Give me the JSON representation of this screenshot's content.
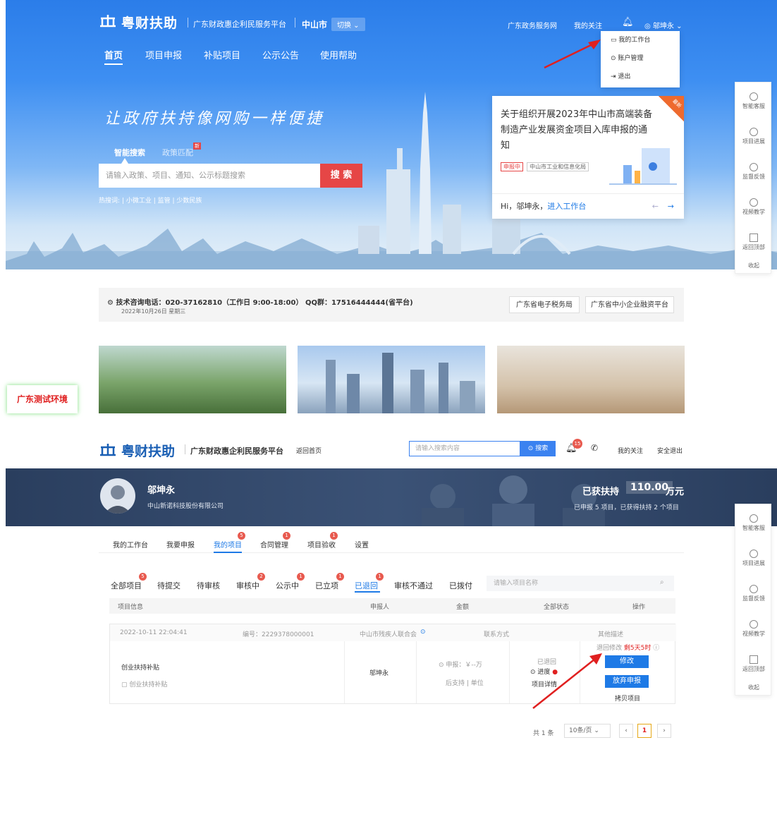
{
  "top": {
    "logo_text": "粤财扶助",
    "platform": "广东财政惠企利民服务平台",
    "city": "中山市",
    "switch_label": "切换",
    "links": [
      "广东政务服务网",
      "我的关注"
    ],
    "user": "邬坤永",
    "nav": [
      "首页",
      "项目申报",
      "补贴项目",
      "公示公告",
      "使用帮助"
    ],
    "dropdown": [
      "我的工作台",
      "账户管理",
      "退出"
    ]
  },
  "hero": {
    "slogan": "让政府扶持像网购一样便捷",
    "tab_search": "智能搜索",
    "tab_policy": "政策匹配",
    "new_badge": "新",
    "search_placeholder": "请输入政策、项目、通知、公示标题搜索",
    "search_btn": "搜 索",
    "hot_label": "热搜词:",
    "hot_words": [
      "小微工业",
      "监管",
      "少数民族"
    ]
  },
  "notice": {
    "title": "关于组织开展2023年中山市高端装备制造产业发展资金项目入库申报的通知",
    "status": "申报中",
    "dept": "中山市工业和信息化局",
    "ribbon": "最新",
    "greeting": "Hi，邬坤永，",
    "enter": "进入工作台",
    "prev": "←",
    "next": "→"
  },
  "side1": [
    "智能客服",
    "项目进展",
    "监督反馈",
    "视频教学",
    "返回顶部",
    "收起"
  ],
  "info": {
    "phone": "技术咨询电话：020-37162810（工作日 9:00-18:00） QQ群：17516444444(省平台)",
    "date": "2022年10月26日 星期三",
    "btn1": "广东省电子税务局",
    "btn2": "广东省中小企业融资平台"
  },
  "test_env": "广东测试环境",
  "bottom": {
    "logo_text": "粤财扶助",
    "platform": "广东财政惠企利民服务平台",
    "back_home": "返回首页",
    "search_placeholder": "请输入搜索内容",
    "search_btn": "搜索",
    "bell_count": "15",
    "follow": "我的关注",
    "logout": "安全退出"
  },
  "profile": {
    "name": "邬坤永",
    "company": "中山新诺科技股份有限公司",
    "support_label": "已获扶持",
    "support_value": "110.00",
    "support_unit": "万元",
    "summary": "已申报 5 项目，已获得扶持 2 个项目"
  },
  "tabs": [
    {
      "label": "我的工作台",
      "badge": ""
    },
    {
      "label": "我要申报",
      "badge": ""
    },
    {
      "label": "我的项目",
      "badge": "5"
    },
    {
      "label": "合同管理",
      "badge": "1"
    },
    {
      "label": "项目验收",
      "badge": "1"
    },
    {
      "label": "设置",
      "badge": ""
    }
  ],
  "status_tabs": [
    {
      "label": "全部项目",
      "badge": "5"
    },
    {
      "label": "待提交",
      "badge": ""
    },
    {
      "label": "待审核",
      "badge": ""
    },
    {
      "label": "审核中",
      "badge": "2"
    },
    {
      "label": "公示中",
      "badge": "1"
    },
    {
      "label": "已立项",
      "badge": "1"
    },
    {
      "label": "已退回",
      "badge": "1"
    },
    {
      "label": "审核不通过",
      "badge": ""
    },
    {
      "label": "已拨付",
      "badge": ""
    }
  ],
  "project_search_placeholder": "请输入项目名称",
  "columns": [
    "项目信息",
    "申报人",
    "金额",
    "全部状态",
    "操作"
  ],
  "row": {
    "time": "2022-10-11 22:04:41",
    "code": "编号：2229378000001",
    "org": "中山市残疾人联合会",
    "contact": "联系方式",
    "other": "其他描述",
    "name": "创业扶持补贴",
    "sub_name": "创业扶持补贴",
    "applicant": "邬坤永",
    "amount": "申报：￥--万",
    "amount_sub": "后支持 | 单位",
    "status": "已退回",
    "progress": "进度",
    "detail": "项目详情",
    "deadline_label": "退回修改",
    "deadline_val": "剩5天5时",
    "btn_edit": "修改",
    "btn_abandon": "放弃申报",
    "copy": "拷贝项目"
  },
  "pager": {
    "total": "共 1 条",
    "per_page": "10条/页",
    "current": "1"
  }
}
